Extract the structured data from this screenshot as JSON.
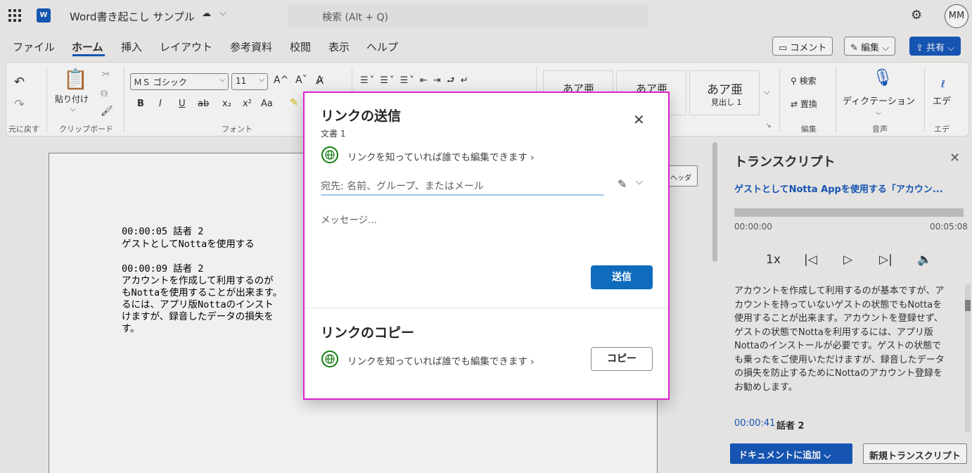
{
  "titlebar": {
    "doc_title": "Word書き起こし サンプル",
    "sync_icon": "cloud-sync-icon",
    "search_placeholder": "検索 (Alt + Q)",
    "avatar_initials": "MM"
  },
  "tabs": [
    "ファイル",
    "ホーム",
    "挿入",
    "レイアウト",
    "参考資料",
    "校閲",
    "表示",
    "ヘルプ"
  ],
  "active_tab": "ホーム",
  "topbar_buttons": {
    "comment": "コメント",
    "edit": "編集",
    "share": "共有"
  },
  "ribbon": {
    "undo_label": "元に戻す",
    "paste_label": "貼り付け",
    "clipboard_label": "クリップボード",
    "font_name": "ＭＳ ゴシック",
    "font_size": "11",
    "font_label": "フォント",
    "format_buttons": [
      "B",
      "I",
      "U",
      "ab",
      "x₂",
      "x²",
      "Aa"
    ],
    "grow_font": "A^",
    "shrink_font": "Aˇ",
    "styles": [
      {
        "preview": "あア亜",
        "name": ""
      },
      {
        "preview": "あア亜",
        "name": ""
      },
      {
        "preview": "あア亜",
        "name": "見出し 1"
      }
    ],
    "find_label": "検索",
    "replace_label": "置換",
    "edit_group_label": "編集",
    "dictation_label": "ディクテーション",
    "voice_label": "音声",
    "editor_label": "エデ",
    "editor_group_label": "エデ"
  },
  "document": {
    "lines_block1": [
      "00:00:05 話者 2",
      "ゲストとしてNottaを使用する"
    ],
    "lines_block2": [
      "00:00:09 話者 2",
      "アカウントを作成して利用するのが",
      "もNottaを使用することが出来ます。",
      "るには、アプリ版Nottaのインスト",
      "けますが、録音したデータの損失を",
      "す。"
    ],
    "header_button": "ヘッダー"
  },
  "transcript": {
    "title": "トランスクリプト",
    "link": "ゲストとしてNotta Appを使用する「アカウン...",
    "time_start": "00:00:00",
    "time_end": "00:05:08",
    "speed": "1x",
    "body": "アカウントを作成して利用するのが基本ですが、アカウントを持っていないゲストの状態でもNottaを使用することが出来ます。アカウントを登録せず、ゲストの状態でNottaを利用するには、アプリ版Nottaのインストールが必要です。ゲストの状態でも乗ったをご使用いただけますが、録音したデータの損失を防止するためにNottaのアカウント登録をお勧めします。",
    "next_timestamp": "00:00:41",
    "next_speaker": "話者 2",
    "add_to_doc_button": "ドキュメントに追加",
    "new_transcript_button": "新規トランスクリプト"
  },
  "dialog": {
    "title": "リンクの送信",
    "subtitle": "文書 1",
    "permission": "リンクを知っていれば誰でも編集できます",
    "to_placeholder": "宛先: 名前、グループ、またはメール",
    "message_placeholder": "メッセージ...",
    "send_button": "送信",
    "copy_title": "リンクのコピー",
    "copy_permission": "リンクを知っていれば誰でも編集できます",
    "copy_button": "コピー"
  },
  "colors": {
    "brand_blue": "#185abd",
    "highlight_border": "#e020d0",
    "globe_green": "#107c10"
  }
}
